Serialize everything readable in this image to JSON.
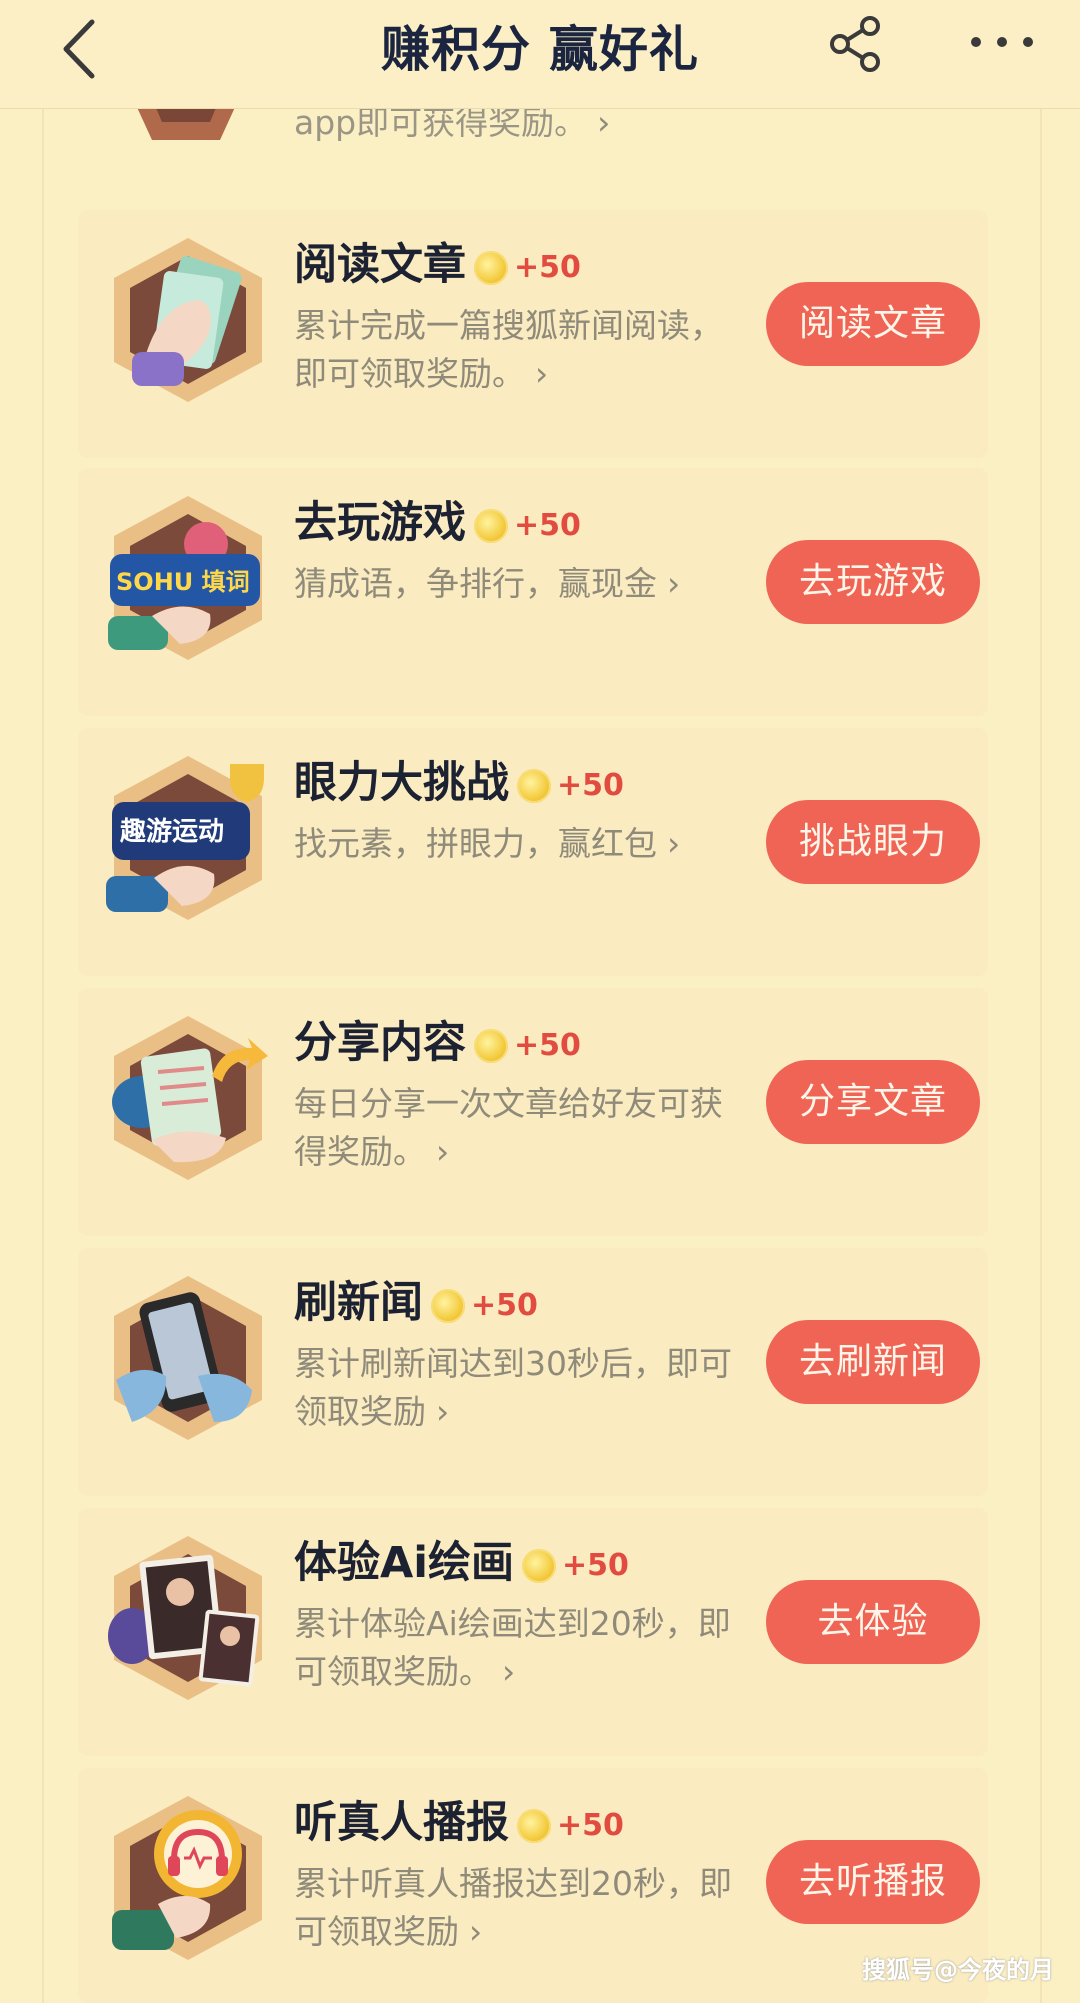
{
  "header": {
    "title": "赚积分 赢好礼",
    "back_icon": "chevron-left-icon",
    "share_icon": "share-icon",
    "more_icon": "more-icon"
  },
  "partial_item": {
    "desc": "app即可获得奖励。",
    "chevron": "›"
  },
  "tasks": [
    {
      "title": "阅读文章",
      "points": "+50",
      "desc": "累计完成一篇搜狐新闻阅读，即可领取奖励。",
      "chevron": "›",
      "button": "阅读文章",
      "icon": "reading-hand-icon"
    },
    {
      "title": "去玩游戏",
      "points": "+50",
      "desc": "猜成语，争排行，赢现金",
      "chevron": "›",
      "button": "去玩游戏",
      "icon": "game-icon"
    },
    {
      "title": "眼力大挑战",
      "points": "+50",
      "desc": "找元素，拼眼力，赢红包",
      "chevron": "›",
      "button": "挑战眼力",
      "icon": "trophy-game-icon"
    },
    {
      "title": "分享内容",
      "points": "+50",
      "desc": "每日分享一次文章给好友可获得奖励。",
      "chevron": "›",
      "button": "分享文章",
      "icon": "share-article-icon"
    },
    {
      "title": "刷新闻",
      "points": "+50",
      "desc": "累计刷新闻达到30秒后，即可领取奖励",
      "chevron": "›",
      "button": "去刷新闻",
      "icon": "phone-news-icon"
    },
    {
      "title": "体验Ai绘画",
      "points": "+50",
      "desc": "累计体验Ai绘画达到20秒，即可领取奖励。",
      "chevron": "›",
      "button": "去体验",
      "icon": "ai-painting-icon"
    },
    {
      "title": "听真人播报",
      "points": "+50",
      "desc": "累计听真人播报达到20秒，即可领取奖励",
      "chevron": "›",
      "button": "去听播报",
      "icon": "headphones-icon"
    }
  ],
  "watermark": "搜狐号@今夜的月",
  "colors": {
    "background": "#fbefc4",
    "button": "#f06455",
    "points": "#e24b3f",
    "title": "#1b2540"
  }
}
